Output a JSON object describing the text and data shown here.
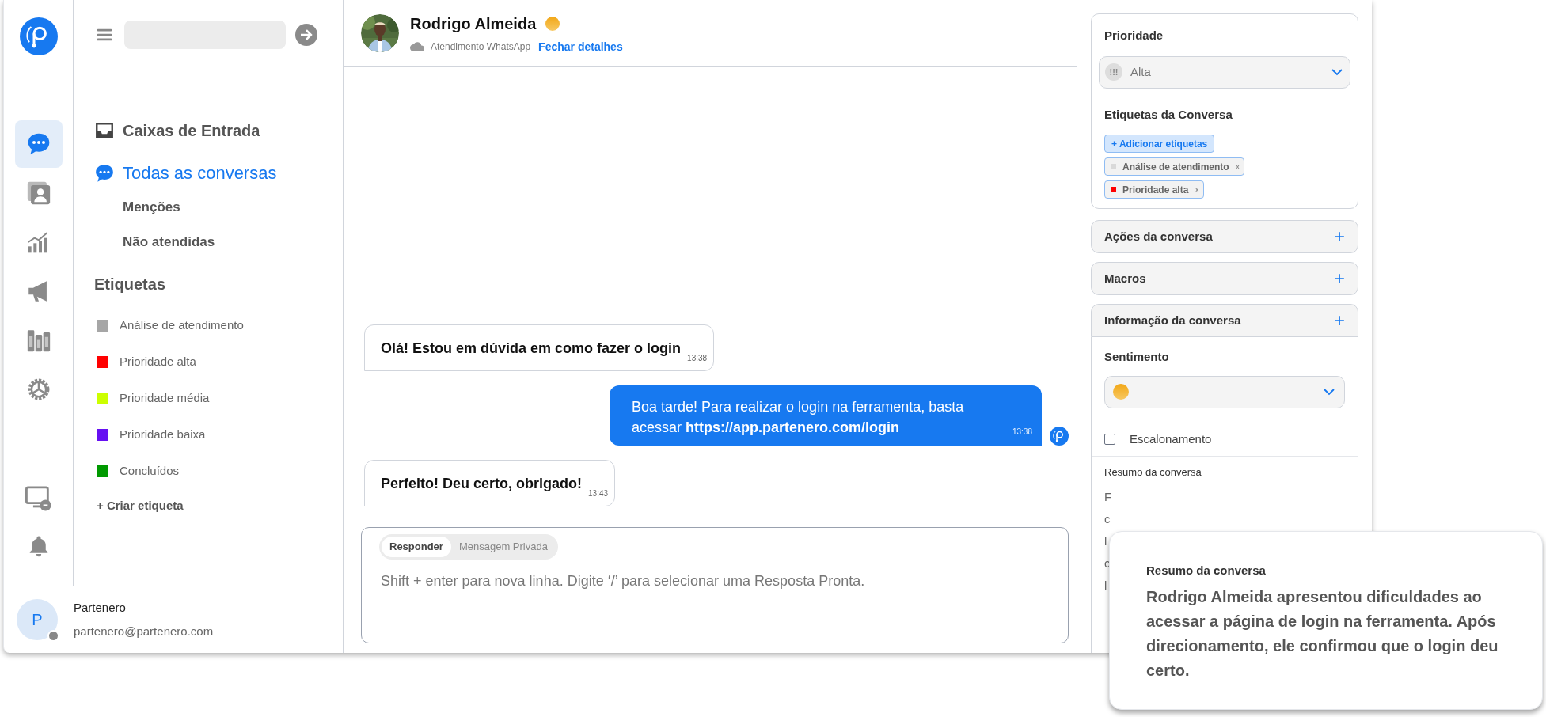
{
  "rail": {
    "items": [
      {
        "kind": "chat",
        "selected": true
      },
      {
        "kind": "contacts",
        "selected": false
      },
      {
        "kind": "reports",
        "selected": false
      },
      {
        "kind": "campaigns",
        "selected": false
      },
      {
        "kind": "library",
        "selected": false
      },
      {
        "kind": "settings",
        "selected": false
      }
    ],
    "bottom_items": [
      {
        "kind": "monitor"
      },
      {
        "kind": "bell"
      }
    ]
  },
  "nav": {
    "inbox": "Caixas de Entrada",
    "items": [
      {
        "label": "Todas as conversas",
        "selected": true
      },
      {
        "label": "Menções",
        "selected": false
      },
      {
        "label": "Não atendidas",
        "selected": false
      }
    ],
    "labels_title": "Etiquetas",
    "labels": [
      {
        "label": "Análise de atendimento",
        "color": "#a6a6a6"
      },
      {
        "label": "Prioridade alta",
        "color": "#ff0000"
      },
      {
        "label": "Prioridade média",
        "color": "#ccff00"
      },
      {
        "label": "Prioridade baixa",
        "color": "#6610f2"
      },
      {
        "label": "Concluídos",
        "color": "#009900"
      }
    ],
    "create_label": "+ Criar etiqueta"
  },
  "user": {
    "initial": "P",
    "name": "Partenero",
    "email": "partenero@partenero.com"
  },
  "header": {
    "name": "Rodrigo Almeida",
    "channel": "Atendimento WhatsApp",
    "link": "Fechar detalhes"
  },
  "messages": [
    {
      "kind": "incoming",
      "text": "Olá! Estou em dúvida em como fazer o login",
      "time": "13:38"
    },
    {
      "kind": "outgoing",
      "text": "Boa tarde! Para realizar o login na ferramenta, basta acessar **https://app.partenero.com/login**",
      "time": "13:38"
    },
    {
      "kind": "incoming",
      "text": "Perfeito! Deu certo, obrigado!",
      "time": "13:43"
    }
  ],
  "composer": {
    "tabs": [
      {
        "label": "Responder",
        "selected": true
      },
      {
        "label": "Mensagem Privada",
        "selected": false
      }
    ],
    "placeholder": "Shift + enter para nova linha. Digite ‘/’ para selecionar uma Resposta Pronta."
  },
  "details": {
    "priority_title": "Prioridade",
    "priority": {
      "icon": "!!!",
      "value": "Alta"
    },
    "tags_title": "Etiquetas da Conversa",
    "add_tag": "+ Adicionar etiquetas",
    "tags": [
      {
        "label": "Análise de atendimento",
        "color": "#d9d9d9",
        "remove": "x"
      },
      {
        "label": "Prioridade alta",
        "color": "#ff0000",
        "remove": "x"
      }
    ],
    "sections": [
      {
        "label": "Ações da conversa",
        "icon": "+"
      },
      {
        "label": "Macros",
        "icon": "+"
      },
      {
        "label": "Informação da conversa",
        "icon": "+"
      }
    ],
    "sentiment_title": "Sentimento",
    "escalation": {
      "label": "Escalonamento",
      "checked": false
    },
    "summary_title": "Resumo da conversa",
    "summary_fragments": [
      "F",
      "c",
      "l",
      "c",
      "l"
    ]
  },
  "tooltip": {
    "title": "Resumo da conversa",
    "text": "Rodrigo Almeida apresentou dificuldades ao acessar a página de login na ferramenta. Após direcionamento, ele confirmou que o login deu certo."
  }
}
